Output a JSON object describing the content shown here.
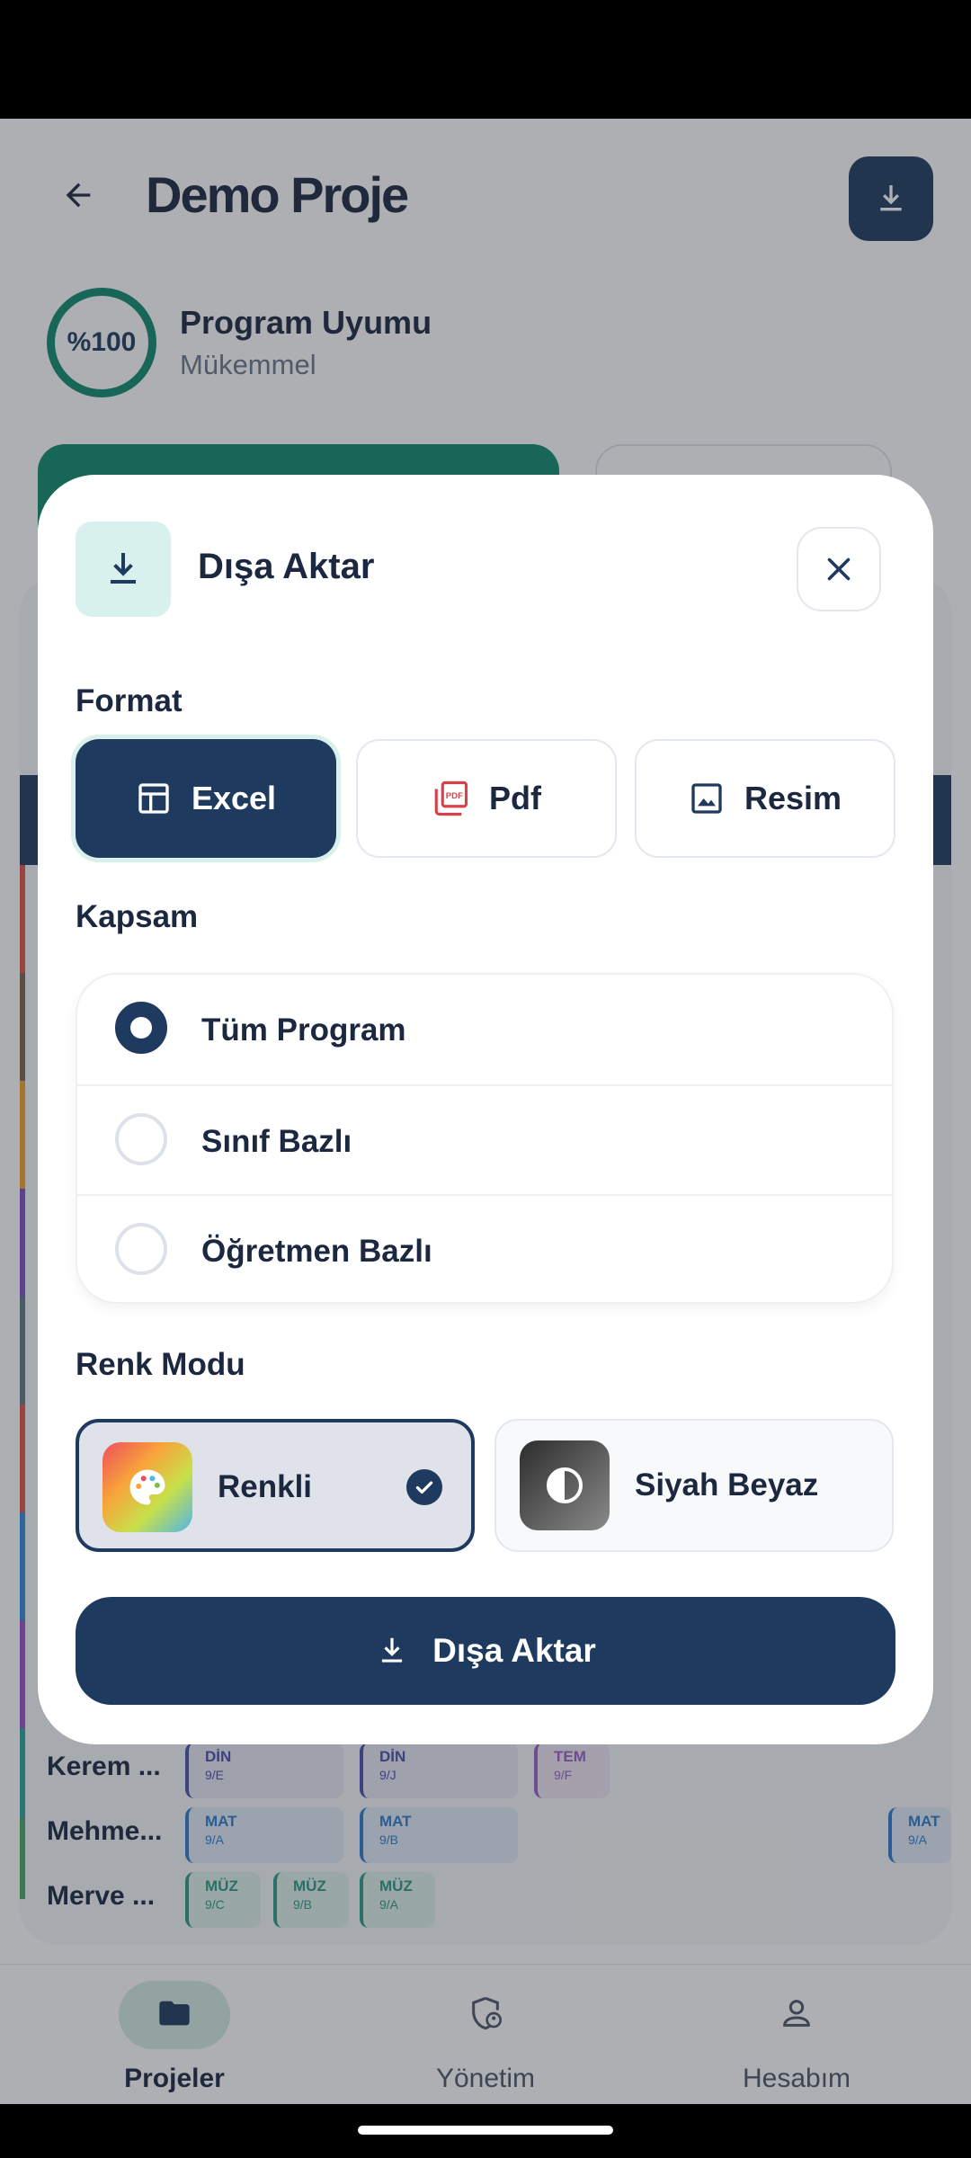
{
  "header": {
    "title": "Demo Proje"
  },
  "compliance": {
    "score_label": "%100",
    "title": "Program Uyumu",
    "status": "Mükemmel"
  },
  "background_rows": [
    {
      "name": "Kerem ...",
      "chips": [
        {
          "subject": "DİN",
          "cls": "9/E"
        },
        {
          "subject": "DİN",
          "cls": "9/J"
        },
        {
          "subject": "TEM",
          "cls": "9/F"
        }
      ]
    },
    {
      "name": "Mehme...",
      "chips": [
        {
          "subject": "MAT",
          "cls": "9/A"
        },
        {
          "subject": "MAT",
          "cls": "9/B"
        },
        {
          "subject": "MAT",
          "cls": "9/A"
        }
      ]
    },
    {
      "name": "Merve ...",
      "chips": [
        {
          "subject": "MÜZ",
          "cls": "9/C"
        },
        {
          "subject": "MÜZ",
          "cls": "9/B"
        },
        {
          "subject": "MÜZ",
          "cls": "9/A"
        }
      ]
    }
  ],
  "bottom_nav": [
    {
      "label": "Projeler",
      "icon": "folder-icon",
      "active": true
    },
    {
      "label": "Yönetim",
      "icon": "shield-person-icon",
      "active": false
    },
    {
      "label": "Hesabım",
      "icon": "person-icon",
      "active": false
    }
  ],
  "dialog": {
    "title": "Dışa Aktar",
    "format_label": "Format",
    "formats": [
      {
        "label": "Excel",
        "icon": "table-icon",
        "selected": true
      },
      {
        "label": "Pdf",
        "icon": "pdf-icon",
        "selected": false
      },
      {
        "label": "Resim",
        "icon": "image-icon",
        "selected": false
      }
    ],
    "scope_label": "Kapsam",
    "scopes": [
      {
        "label": "Tüm Program",
        "selected": true
      },
      {
        "label": "Sınıf Bazlı",
        "selected": false
      },
      {
        "label": "Öğretmen Bazlı",
        "selected": false
      }
    ],
    "color_mode_label": "Renk Modu",
    "color_modes": [
      {
        "label": "Renkli",
        "icon": "palette-icon",
        "selected": true
      },
      {
        "label": "Siyah Beyaz",
        "icon": "contrast-icon",
        "selected": false
      }
    ],
    "submit_label": "Dışa Aktar"
  },
  "colors": {
    "primary": "#1f3a5f",
    "accent": "#0f8a6e",
    "accent_light": "#d9f1ec",
    "pdf_red": "#d9414a"
  }
}
